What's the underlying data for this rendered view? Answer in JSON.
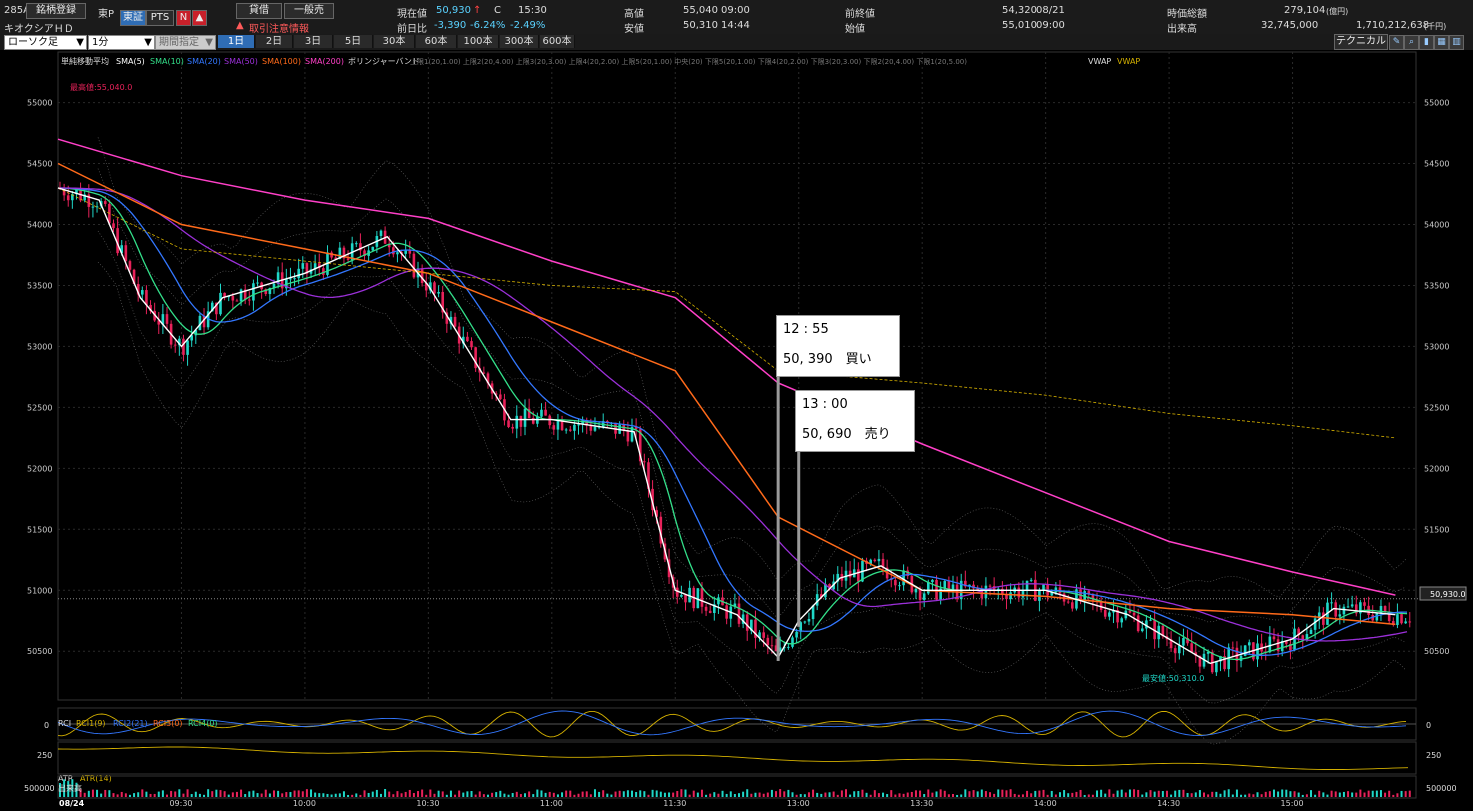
{
  "header": {
    "code": "285A",
    "register_btn": "銘柄登録",
    "market_label": "東P",
    "company_name": "キオクシアＨＤ",
    "exch_tse": "東証",
    "exch_pts": "PTS",
    "n_icon": "N",
    "credit_btn": "貸借",
    "general_btn": "一般売",
    "alert_text": "取引注意情報"
  },
  "quote": {
    "price_label": "現在値",
    "price_value": "50,930",
    "price_flag": "C",
    "price_time": "15:30",
    "change_label": "前日比",
    "change_value": "-3,390",
    "change_pct1": "-6.24%",
    "change_pct2": "-2.49%",
    "high_label": "高値",
    "high_value": "55,040",
    "high_time": "09:00",
    "low_label": "安値",
    "low_value": "50,310",
    "low_time": "14:44",
    "prev_close_label": "前終値",
    "prev_close_value": "54,320",
    "prev_close_date": "08/21",
    "open_label": "始値",
    "open_value": "55,010",
    "open_time": "09:00",
    "mcap_label": "時価総額",
    "mcap_value": "279,104",
    "mcap_unit": "(億円)",
    "volume_label": "出来高",
    "volume_value": "32,745,000",
    "turnover_value": "1,710,212,638",
    "turnover_unit": "(千円)"
  },
  "toolbar": {
    "chart_type": "ローソク足",
    "interval": "1分",
    "period_select": "期間指定",
    "tabs": [
      "1日",
      "2日",
      "3日",
      "5日",
      "30本",
      "60本",
      "100本",
      "300本",
      "600本"
    ],
    "active_tab": "1日",
    "technical_btn": "テクニカル"
  },
  "legend": {
    "ma_title": "単純移動平均",
    "sma5": "SMA(5)",
    "sma10": "SMA(10)",
    "sma20": "SMA(20)",
    "sma50": "SMA(50)",
    "sma100": "SMA(100)",
    "sma200": "SMA(200)",
    "bb_title": "ボリンジャーバンド",
    "bb_items": "上限1(20,1.00)  上限2(20,4.00)  上限3(20,3.00)  上限4(20,2.00)  上限5(20,1.00)  中央(20)  下限5(20,1.00)  下限4(20,2.00)  下限3(20,3.00)  下限2(20,4.00)  下限1(20,5.00)",
    "vwap_title": "VWAP",
    "vwap": "VWAP",
    "high_marker": "最高値:55,040.0",
    "low_marker": "最安値:50,310.0",
    "current_price_tag": "50,930.0"
  },
  "colors": {
    "sma5": "#ffffff",
    "sma10": "#33e08a",
    "sma20": "#3377ff",
    "sma50": "#9b30d9",
    "sma100": "#ff6a1a",
    "sma200": "#ff40c8",
    "vwap": "#d4b000",
    "up": "#1fd7c8",
    "down": "#e8225a"
  },
  "annotations": [
    {
      "time": "12 : 55",
      "text": "50, 390　買い"
    },
    {
      "time": "13 : 00",
      "text": "50, 690　売り"
    }
  ],
  "subpanels": {
    "rci": {
      "title": "RCI",
      "l1": "RCI1(9)",
      "l2": "RCI2(21)",
      "l3": "RCI3(0)",
      "l4": "RCI4(0)",
      "zero_left": "0",
      "zero_right": "0"
    },
    "atr": {
      "title": "ATR",
      "l1": "ATR(14)",
      "left_val": "250",
      "right_val": "250"
    },
    "volume": {
      "title": "出来高",
      "left_val": "500000",
      "right_val": "500000"
    }
  },
  "chart_data": {
    "type": "line",
    "date": "08/24",
    "y_ticks": [
      50500,
      51000,
      51500,
      52000,
      52500,
      53000,
      53500,
      54000,
      54500,
      55000
    ],
    "ylim": [
      50100,
      55300
    ],
    "x_ticks": [
      "09:30",
      "10:00",
      "10:30",
      "11:00",
      "11:30",
      "13:00",
      "13:30",
      "14:00",
      "14:30",
      "15:00"
    ],
    "series": [
      {
        "name": "SMA(5)",
        "x": [
          "09:00",
          "09:10",
          "09:20",
          "09:30",
          "09:40",
          "10:00",
          "10:20",
          "10:30",
          "10:50",
          "11:00",
          "11:20",
          "11:30",
          "12:45",
          "12:55",
          "13:00",
          "13:10",
          "13:20",
          "13:30",
          "14:00",
          "14:20",
          "14:40",
          "14:50",
          "15:00",
          "15:10",
          "15:25"
        ],
        "y": [
          54300,
          54200,
          53400,
          53000,
          53400,
          53600,
          53900,
          53500,
          52400,
          52400,
          52300,
          51000,
          50800,
          50450,
          50750,
          51100,
          51200,
          51000,
          51000,
          50800,
          50400,
          50500,
          50600,
          50850,
          50800
        ]
      },
      {
        "name": "SMA(100)",
        "x": [
          "09:00",
          "09:30",
          "10:00",
          "10:30",
          "11:00",
          "11:30",
          "12:55",
          "13:30",
          "14:00",
          "14:30",
          "15:00",
          "15:25"
        ],
        "y": [
          54500,
          54000,
          53800,
          53600,
          53200,
          52800,
          51600,
          51000,
          50950,
          50850,
          50800,
          50720
        ]
      },
      {
        "name": "SMA(200)",
        "x": [
          "09:00",
          "09:30",
          "10:00",
          "10:30",
          "11:00",
          "11:30",
          "12:55",
          "13:30",
          "14:00",
          "14:30",
          "15:00",
          "15:25"
        ],
        "y": [
          54700,
          54400,
          54200,
          54050,
          53700,
          53400,
          52700,
          52200,
          51800,
          51400,
          51150,
          50960
        ]
      },
      {
        "name": "VWAP",
        "x": [
          "09:00",
          "09:30",
          "10:00",
          "10:30",
          "11:00",
          "11:30",
          "12:55",
          "13:30",
          "14:00",
          "14:30",
          "15:00",
          "15:25"
        ],
        "y": [
          54300,
          53800,
          53700,
          53600,
          53500,
          53450,
          52800,
          52700,
          52600,
          52450,
          52350,
          52250
        ]
      }
    ]
  }
}
